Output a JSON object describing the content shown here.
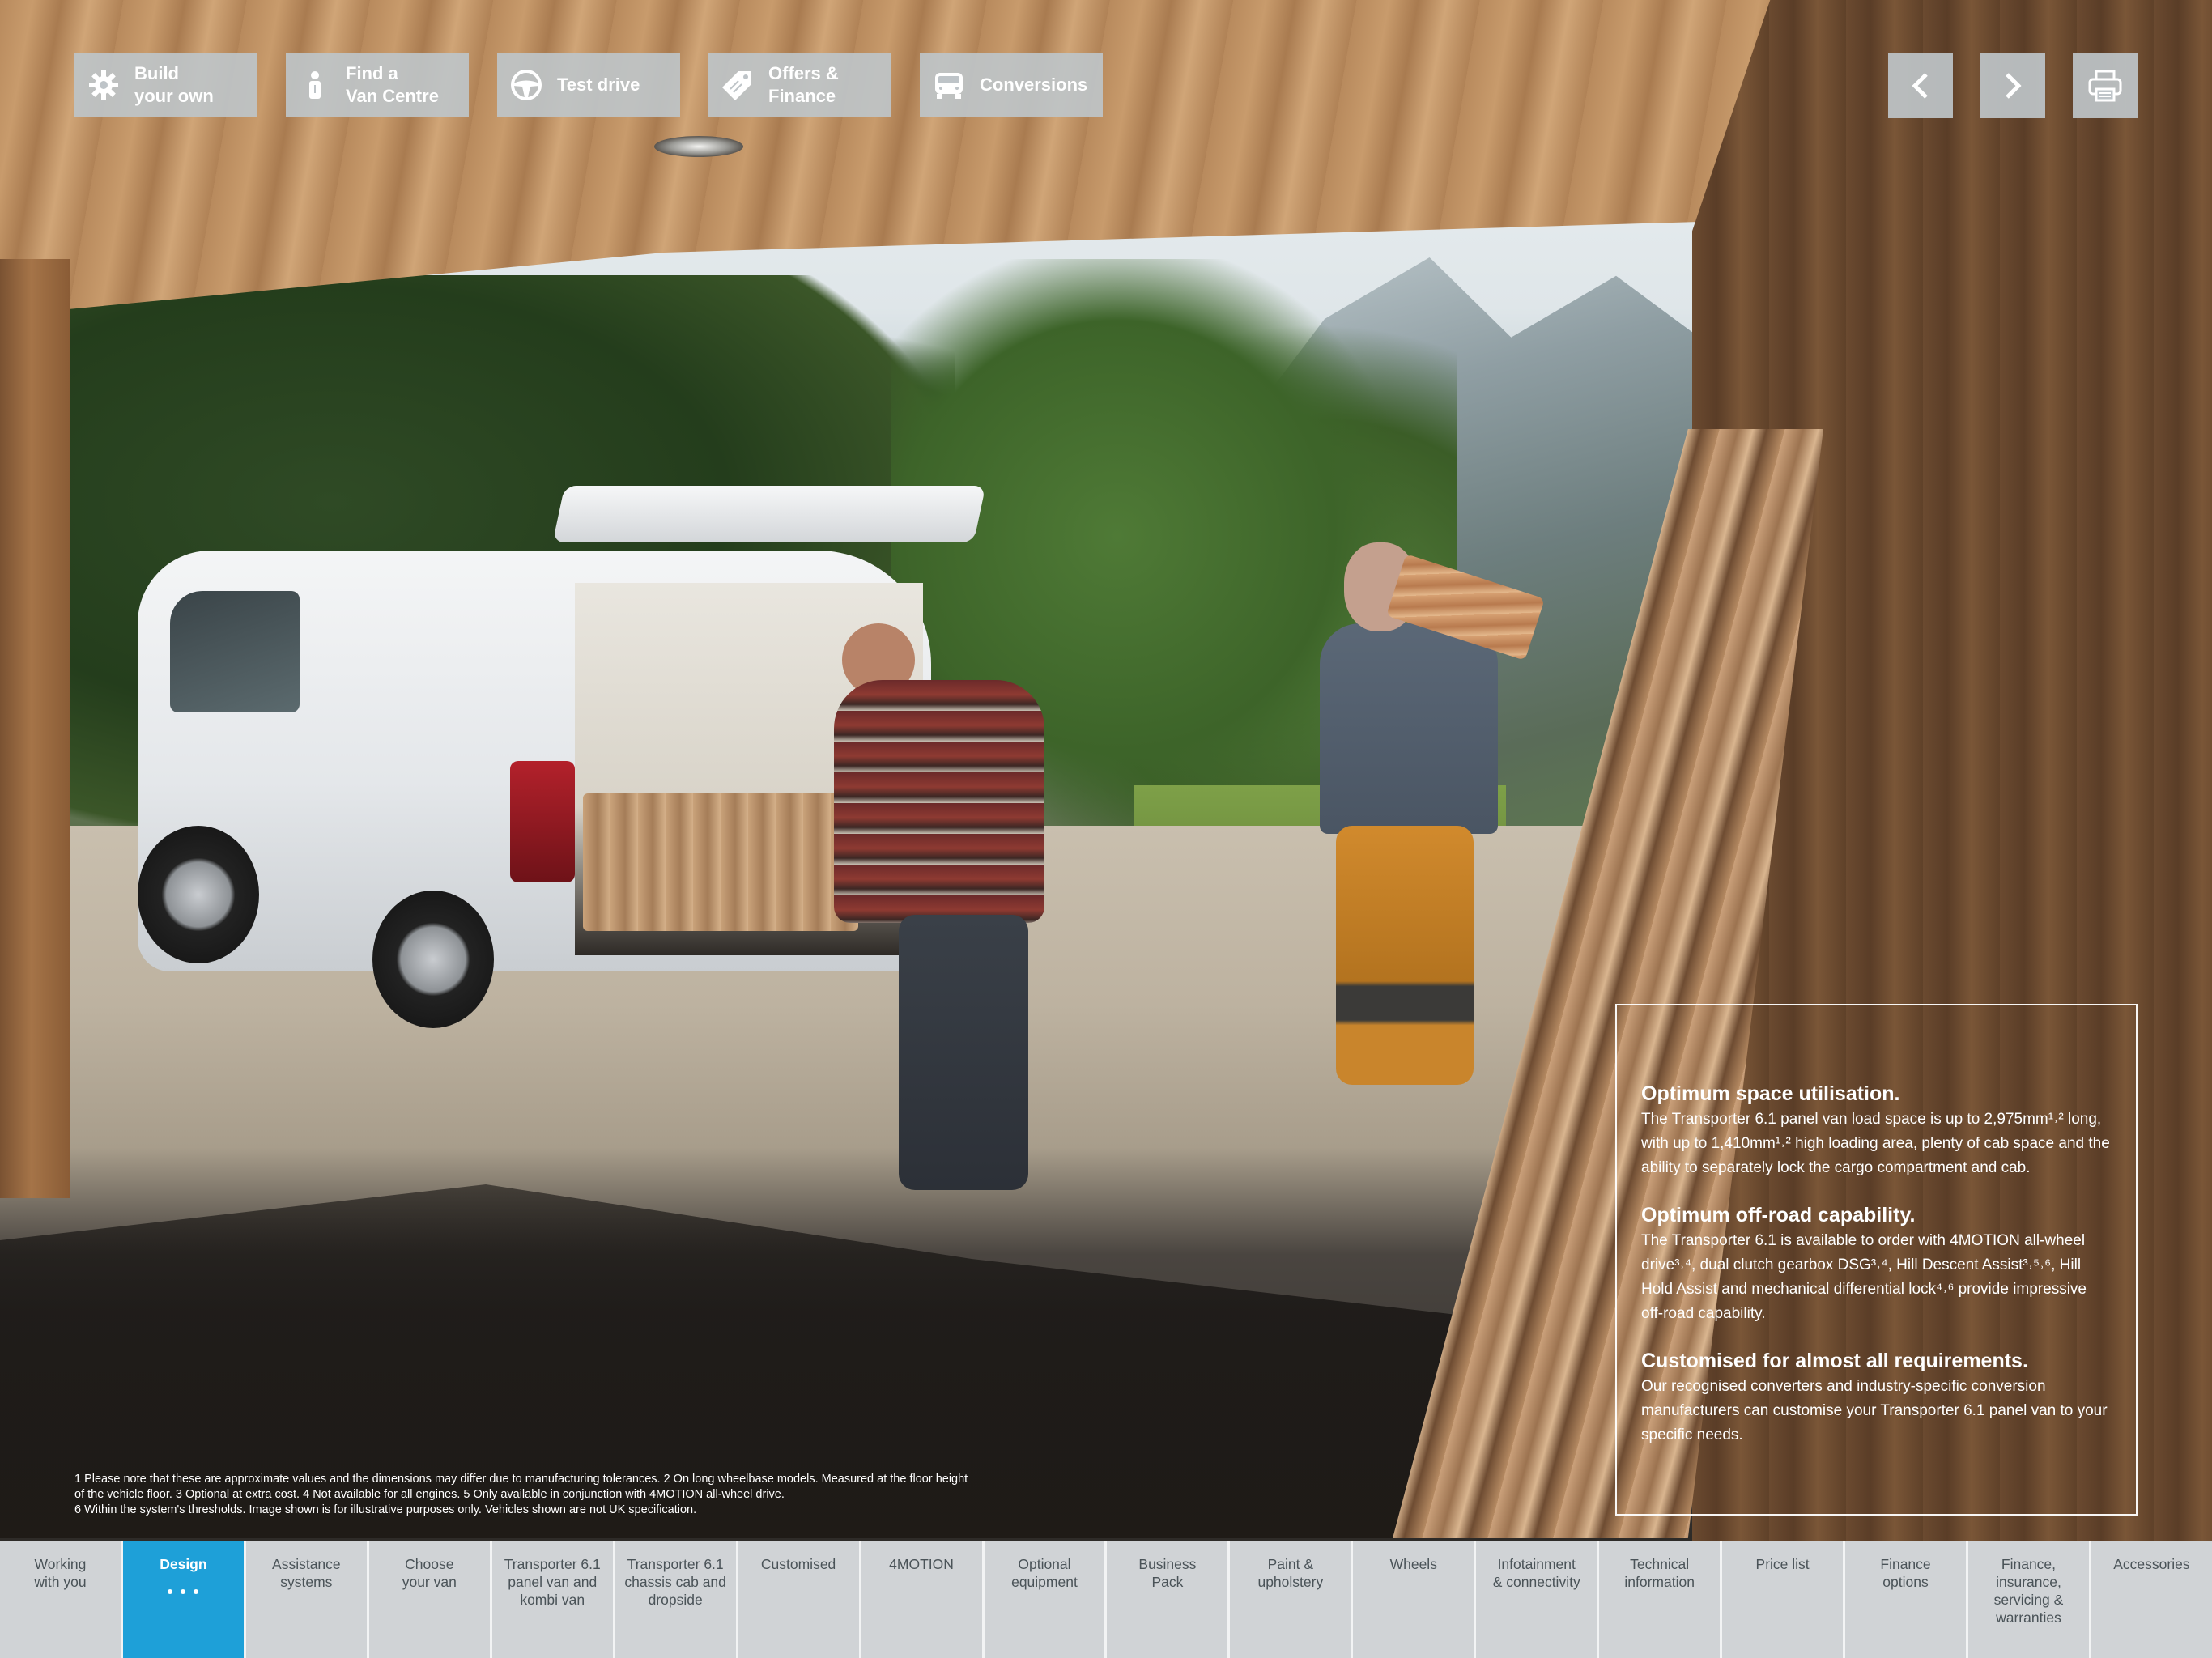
{
  "toolbar": {
    "buttons": [
      {
        "label": "Build\nyour own",
        "icon": "gear-icon"
      },
      {
        "label": "Find a\nVan Centre",
        "icon": "person-icon"
      },
      {
        "label": "Test drive",
        "icon": "steering-wheel-icon"
      },
      {
        "label": "Offers &\nFinance",
        "icon": "price-tag-icon"
      },
      {
        "label": "Conversions",
        "icon": "van-icon"
      }
    ],
    "right_buttons": [
      "previous-page",
      "next-page",
      "print"
    ]
  },
  "info_box": {
    "sections": [
      {
        "title": "Optimum space utilisation.",
        "body": "The Transporter 6.1 panel van load space is up to 2,975mm¹˒² long, with up to 1,410mm¹˒² high loading area, plenty of cab space and the ability to separately lock the cargo compartment and cab."
      },
      {
        "title": "Optimum off-road capability.",
        "body": "The Transporter 6.1 is available to order with 4MOTION all-wheel drive³˒⁴, dual clutch gearbox DSG³˒⁴, Hill Descent Assist³˒⁵˒⁶, Hill Hold Assist and mechanical differential lock⁴˒⁶ provide impressive off-road capability."
      },
      {
        "title": "Customised for almost all requirements.",
        "body": "Our recognised converters and industry-specific conversion manufacturers can customise your Transporter 6.1 panel van to your specific needs."
      }
    ]
  },
  "footnotes": {
    "line1": "1 Please note that these are approximate values and the dimensions may differ due to manufacturing tolerances.    2 On long wheelbase models. Measured at the floor height",
    "line2": "of the vehicle floor.    3 Optional at extra cost.    4 Not available for all engines.    5 Only available in conjunction with 4MOTION all-wheel drive.",
    "line3": "6 Within the system's thresholds.    Image shown is for illustrative purposes only. Vehicles shown are not UK specification."
  },
  "tabs": [
    {
      "label": "Working\nwith you",
      "active": false
    },
    {
      "label": "Design",
      "active": true
    },
    {
      "label": "Assistance\nsystems",
      "active": false
    },
    {
      "label": "Choose\nyour van",
      "active": false
    },
    {
      "label": "Transporter 6.1\npanel van and\nkombi van",
      "active": false
    },
    {
      "label": "Transporter 6.1\nchassis cab and\ndropside",
      "active": false
    },
    {
      "label": "Customised",
      "active": false
    },
    {
      "label": "4MOTION",
      "active": false
    },
    {
      "label": "Optional\nequipment",
      "active": false
    },
    {
      "label": "Business\nPack",
      "active": false
    },
    {
      "label": "Paint &\nupholstery",
      "active": false
    },
    {
      "label": "Wheels",
      "active": false
    },
    {
      "label": "Infotainment\n& connectivity",
      "active": false
    },
    {
      "label": "Technical\ninformation",
      "active": false
    },
    {
      "label": "Price list",
      "active": false
    },
    {
      "label": "Finance\noptions",
      "active": false
    },
    {
      "label": "Finance,\ninsurance,\nservicing &\nwarranties",
      "active": false
    },
    {
      "label": "Accessories",
      "active": false
    }
  ],
  "colors": {
    "active_tab": "#1ea0d8",
    "tab_bg": "#d0d3d6",
    "toolbar_button": "#bec4c8"
  }
}
